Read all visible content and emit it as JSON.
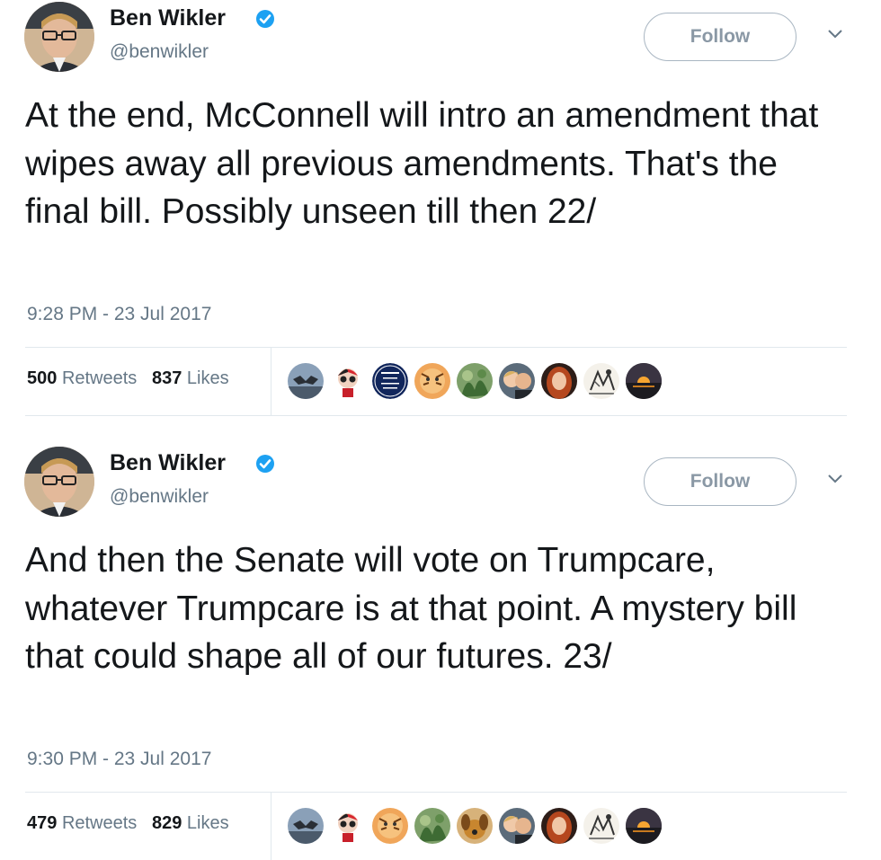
{
  "tweets": [
    {
      "author": {
        "name": "Ben Wikler",
        "handle": "@benwikler",
        "verified": true
      },
      "follow_label": "Follow",
      "menu_icon": "chevron-down-icon",
      "text": "At the end, McConnell will intro an amendment that wipes away all previous amendments. That's the final bill. Possibly unseen till then 22/",
      "timestamp": "9:28 PM - 23 Jul 2017",
      "retweets": {
        "count": "500",
        "label": "Retweets"
      },
      "likes": {
        "count": "837",
        "label": "Likes"
      },
      "likers": [
        "bat-avatar",
        "harley-avatar",
        "defend-it-badge-avatar",
        "tiger-avatar",
        "plants-avatar",
        "couple-avatar",
        "redhead-avatar",
        "sketch-avatar",
        "sunset-avatar"
      ]
    },
    {
      "author": {
        "name": "Ben Wikler",
        "handle": "@benwikler",
        "verified": true
      },
      "follow_label": "Follow",
      "menu_icon": "chevron-down-icon",
      "text": "And then the Senate will vote on Trumpcare, whatever Trumpcare is at that point. A mystery bill that could shape all of our futures. 23/",
      "timestamp": "9:30 PM - 23 Jul 2017",
      "retweets": {
        "count": "479",
        "label": "Retweets"
      },
      "likes": {
        "count": "829",
        "label": "Likes"
      },
      "likers": [
        "bat-avatar",
        "harley-avatar",
        "tiger-avatar",
        "plants-avatar",
        "dog-avatar",
        "couple-avatar",
        "redhead-avatar",
        "sketch-avatar",
        "sunset-avatar"
      ]
    }
  ],
  "colors": {
    "text": "#14171a",
    "secondary": "#657786",
    "verified": "#1da1f2",
    "divider": "#e1e8ed",
    "follow_border": "#a9b6c2"
  }
}
